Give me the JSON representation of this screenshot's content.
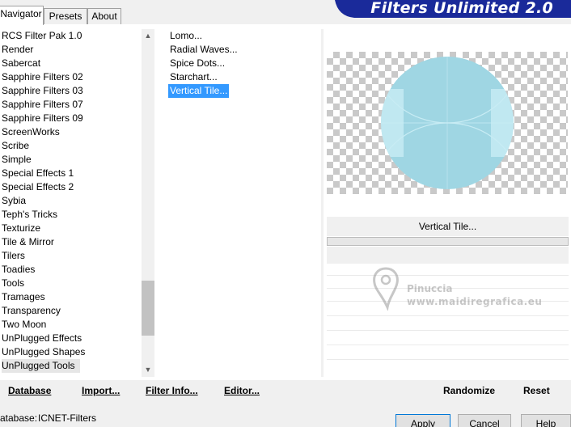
{
  "tabs": [
    {
      "label": "Navigator"
    },
    {
      "label": "Presets"
    },
    {
      "label": "About"
    }
  ],
  "banner": {
    "title": "Filters Unlimited 2.0",
    "color": "#1a2a9a"
  },
  "categories": [
    "RCS Filter Pak 1.0",
    "Render",
    "Sabercat",
    "Sapphire Filters 02",
    "Sapphire Filters 03",
    "Sapphire Filters 07",
    "Sapphire Filters 09",
    "ScreenWorks",
    "Scribe",
    "Simple",
    "Special Effects 1",
    "Special Effects 2",
    "Sybia",
    "Teph's Tricks",
    "Texturize",
    "Tile & Mirror",
    "Tilers",
    "Toadies",
    "Tools",
    "Tramages",
    "Transparency",
    "Two Moon",
    "UnPlugged Effects",
    "UnPlugged Shapes",
    "UnPlugged Tools"
  ],
  "selected_category": "UnPlugged Tools",
  "filters": [
    "Lomo...",
    "Radial Waves...",
    "Spice Dots...",
    "Starchart...",
    "Vertical Tile..."
  ],
  "selected_filter": "Vertical Tile...",
  "scrollbar": {
    "up_icon": "triangle-up-icon",
    "down_icon": "triangle-down-icon"
  },
  "preview": {
    "circle_color": "#9fd6e3",
    "highlight_color": "#c8ecf4"
  },
  "filter_name": "Vertical Tile...",
  "progress": {
    "fraction": 0.0
  },
  "watermark": {
    "name": "Pinuccia",
    "url": "www.maidiregrafica.eu"
  },
  "toolbar": {
    "database": "Database",
    "import": "Import...",
    "filter_info": "Filter Info...",
    "editor": "Editor...",
    "randomize": "Randomize",
    "reset": "Reset"
  },
  "footer": {
    "database_label": "atabase:",
    "database_value": "ICNET-Filters"
  },
  "buttons": {
    "apply": "Apply",
    "cancel": "Cancel",
    "help": "Help"
  }
}
